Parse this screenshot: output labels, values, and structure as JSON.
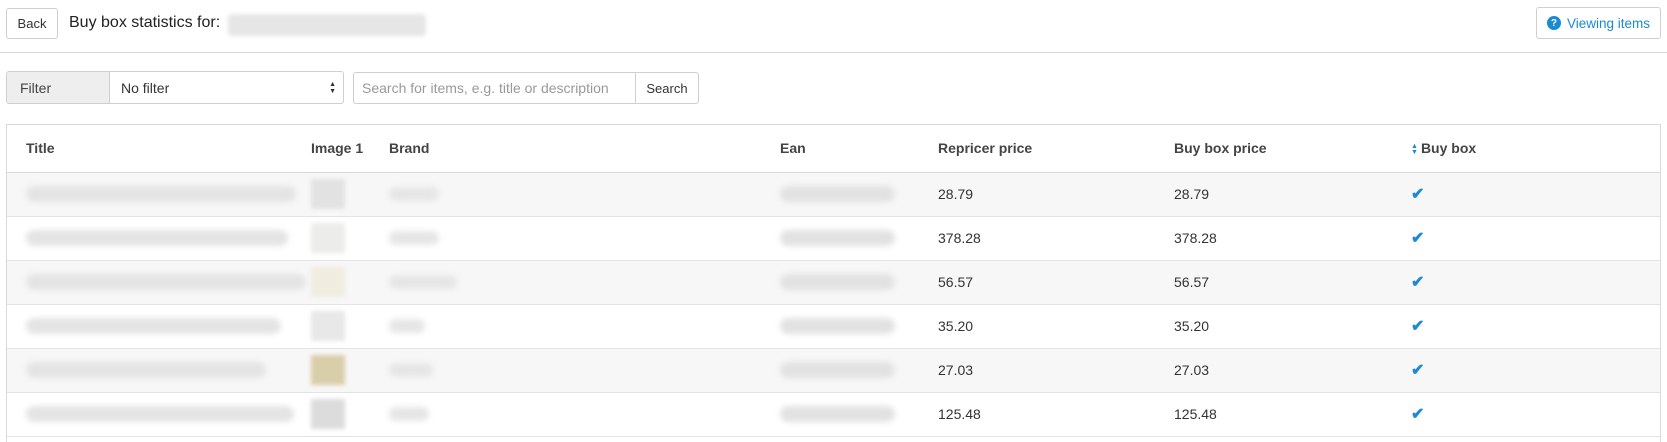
{
  "header": {
    "back_label": "Back",
    "title": "Buy box statistics for:",
    "viewing_label": "Viewing items",
    "help_glyph": "?",
    "accent": "#1a8ad3"
  },
  "filter": {
    "label": "Filter",
    "selected": "No filter",
    "arrow_up": "▲",
    "arrow_down": "▼"
  },
  "search": {
    "placeholder": "Search for items, e.g. title or description",
    "button_label": "Search"
  },
  "table": {
    "columns": [
      "Title",
      "Image 1",
      "Brand",
      "Ean",
      "Repricer price",
      "Buy box price",
      "Buy box"
    ],
    "sort_up": "▲",
    "sort_down": "▼",
    "check_glyph": "✔",
    "rows": [
      {
        "repricer_price": "28.79",
        "buy_box_price": "28.79",
        "buy_box": true
      },
      {
        "repricer_price": "378.28",
        "buy_box_price": "378.28",
        "buy_box": true
      },
      {
        "repricer_price": "56.57",
        "buy_box_price": "56.57",
        "buy_box": true
      },
      {
        "repricer_price": "35.20",
        "buy_box_price": "35.20",
        "buy_box": true
      },
      {
        "repricer_price": "27.03",
        "buy_box_price": "27.03",
        "buy_box": true
      },
      {
        "repricer_price": "125.48",
        "buy_box_price": "125.48",
        "buy_box": true
      }
    ]
  }
}
